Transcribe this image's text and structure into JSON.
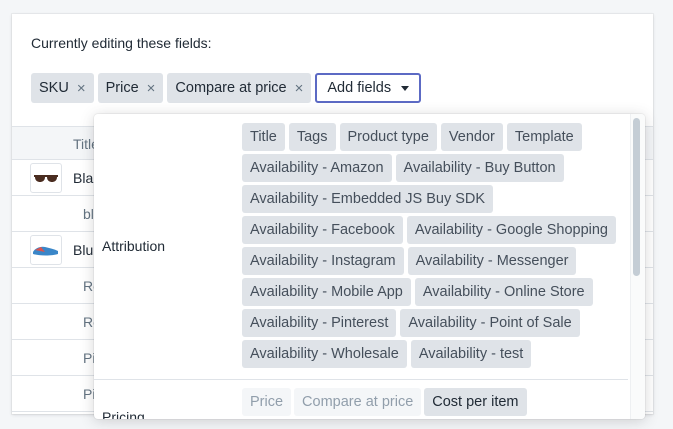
{
  "header": {
    "title": "Currently editing these fields:",
    "selected_fields": [
      "SKU",
      "Price",
      "Compare at price"
    ],
    "add_fields_label": "Add fields"
  },
  "table": {
    "column_title": "Title",
    "rows": [
      {
        "text": "Bla",
        "has_thumb": true
      },
      {
        "text": "bl",
        "sub": true
      },
      {
        "text": "Blu",
        "has_thumb": true
      },
      {
        "text": "Re",
        "sub": true
      },
      {
        "text": "Re",
        "sub": true
      },
      {
        "text": "Pi",
        "sub": true
      },
      {
        "text": "Pi",
        "sub": true
      }
    ]
  },
  "dropdown": {
    "group1": {
      "label": "Attribution",
      "options": [
        "Title",
        "Tags",
        "Product type",
        "Vendor",
        "Template",
        "Availability - Amazon",
        "Availability - Buy Button",
        "Availability - Embedded JS Buy SDK",
        "Availability - Facebook",
        "Availability - Google Shopping",
        "Availability - Instagram",
        "Availability - Messenger",
        "Availability - Mobile App",
        "Availability - Online Store",
        "Availability - Pinterest",
        "Availability - Point of Sale",
        "Availability - Wholesale",
        "Availability - test"
      ]
    },
    "group2": {
      "label": "Pricing",
      "options": [
        {
          "label": "Price",
          "disabled": true
        },
        {
          "label": "Compare at price",
          "disabled": true
        },
        {
          "label": "Cost per item",
          "disabled": false
        }
      ]
    }
  }
}
